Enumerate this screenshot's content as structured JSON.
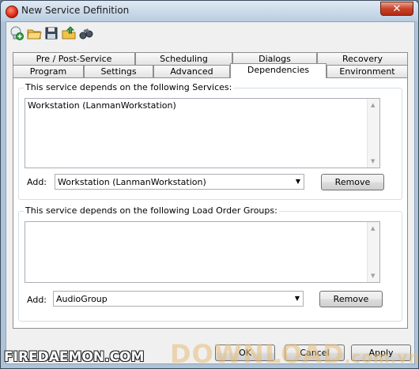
{
  "window": {
    "title": "New Service Definition",
    "close_label": "✕"
  },
  "toolbar": {
    "buttons": [
      {
        "name": "new-icon"
      },
      {
        "name": "open-folder-icon"
      },
      {
        "name": "save-icon"
      },
      {
        "name": "import-icon"
      },
      {
        "name": "binoculars-icon"
      }
    ]
  },
  "tabs": {
    "row_back": [
      "Pre / Post-Service",
      "Scheduling",
      "Dialogs",
      "Recovery"
    ],
    "row_front": [
      "Program",
      "Settings",
      "Advanced",
      "Dependencies",
      "Environment"
    ],
    "active": "Dependencies"
  },
  "services_group": {
    "label": "This service depends on the following Services:",
    "items": [
      "Workstation (LanmanWorkstation)"
    ],
    "add_label": "Add:",
    "add_value": "Workstation (LanmanWorkstation)",
    "remove_label": "Remove"
  },
  "load_order_group": {
    "label": "This service depends on the following Load Order Groups:",
    "items": [],
    "add_label": "Add:",
    "add_value": "AudioGroup",
    "remove_label": "Remove"
  },
  "dialog_buttons": {
    "ok": "OK",
    "cancel": "Cancel",
    "apply": "Apply"
  },
  "watermarks": {
    "left": "FIREDAEMON.COM",
    "right": "DOWNLOAD",
    "right_suffix": ".com.vn"
  }
}
